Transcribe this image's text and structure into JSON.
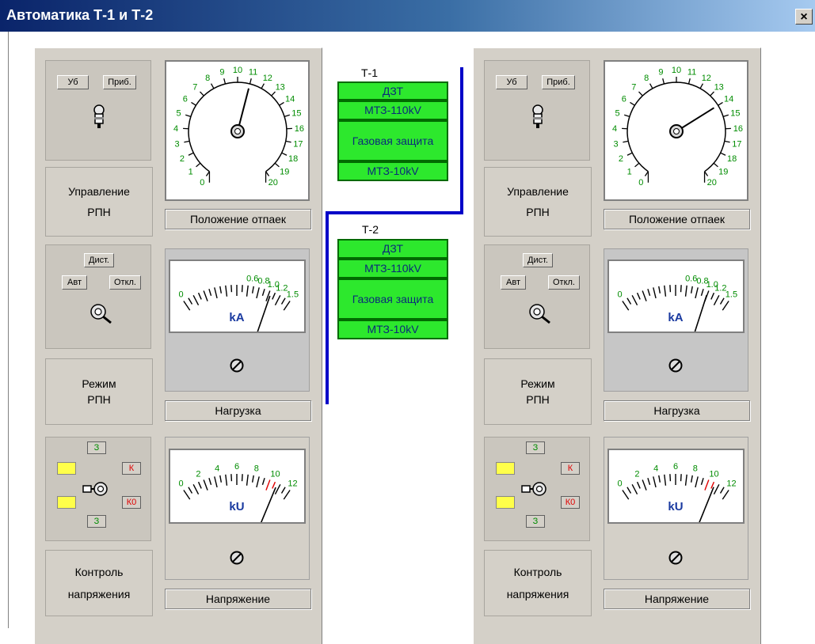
{
  "window": {
    "title": "Автоматика Т-1 и Т-2",
    "close_label": "×"
  },
  "panels": [
    {
      "id": "t1",
      "switch_labels": {
        "ub": "Уб",
        "prib": "Приб."
      },
      "control_label_1": "Управление",
      "control_label_2": "РПН",
      "tap_dial": {
        "ticks": [
          "0",
          "1",
          "2",
          "3",
          "4",
          "5",
          "6",
          "7",
          "8",
          "9",
          "10",
          "11",
          "12",
          "13",
          "14",
          "15",
          "16",
          "17",
          "18",
          "19",
          "20"
        ],
        "position": 11
      },
      "tap_caption": "Положение отпаек",
      "mode_buttons": {
        "dist": "Дист.",
        "avt": "Авт",
        "otkl": "Откл."
      },
      "mode_label_1": "Режим",
      "mode_label_2": "РПН",
      "load_meter": {
        "ticks": [
          "0",
          "0.6",
          "0.8",
          "1.0",
          "1.2",
          "1.5"
        ],
        "unit": "kA",
        "value": 1.0
      },
      "load_caption": "Нагрузка",
      "voltage_indicators": {
        "z_top": "З",
        "k_left": "К",
        "k_right": "К",
        "k0_left": "К0",
        "k0_right": "К0",
        "z_bottom": "З"
      },
      "voltage_label_1": "Контроль",
      "voltage_label_2": "напряжения",
      "voltage_meter": {
        "ticks": [
          "0",
          "2",
          "4",
          "6",
          "8",
          "10",
          "12"
        ],
        "unit": "kU",
        "value": 10.5
      },
      "voltage_caption": "Напряжение"
    },
    {
      "id": "t2",
      "switch_labels": {
        "ub": "Уб",
        "prib": "Приб."
      },
      "control_label_1": "Управление",
      "control_label_2": "РПН",
      "tap_dial": {
        "ticks": [
          "0",
          "1",
          "2",
          "3",
          "4",
          "5",
          "6",
          "7",
          "8",
          "9",
          "10",
          "11",
          "12",
          "13",
          "14",
          "15",
          "16",
          "17",
          "18",
          "19",
          "20"
        ],
        "position": 14
      },
      "tap_caption": "Положение отпаек",
      "mode_buttons": {
        "dist": "Дист.",
        "avt": "Авт",
        "otkl": "Откл."
      },
      "mode_label_1": "Режим",
      "mode_label_2": "РПН",
      "load_meter": {
        "ticks": [
          "0",
          "0.6",
          "0.8",
          "1.0",
          "1.2",
          "1.5"
        ],
        "unit": "kA",
        "value": 0.95
      },
      "load_caption": "Нагрузка",
      "voltage_indicators": {
        "z_top": "З",
        "k_left": "К",
        "k_right": "К",
        "k0_left": "К0",
        "k0_right": "К0",
        "z_bottom": "З"
      },
      "voltage_label_1": "Контроль",
      "voltage_label_2": "напряжения",
      "voltage_meter": {
        "ticks": [
          "0",
          "2",
          "4",
          "6",
          "8",
          "10",
          "12"
        ],
        "unit": "kU",
        "value": 10.4
      },
      "voltage_caption": "Напряжение"
    }
  ],
  "protection": {
    "t1": {
      "title": "Т-1",
      "items": [
        "ДЗТ",
        "МТЗ-110kV",
        "Газовая защита",
        "МТЗ-10kV"
      ]
    },
    "t2": {
      "title": "Т-2",
      "items": [
        "ДЗТ",
        "МТЗ-110kV",
        "Газовая защита",
        "МТЗ-10kV"
      ]
    }
  },
  "colors": {
    "protection_active": "#2de82d",
    "bus": "#0000c8",
    "tick_green": "#008c00",
    "warn_red": "#e00000",
    "indicator_yellow": "#ffff4a"
  }
}
